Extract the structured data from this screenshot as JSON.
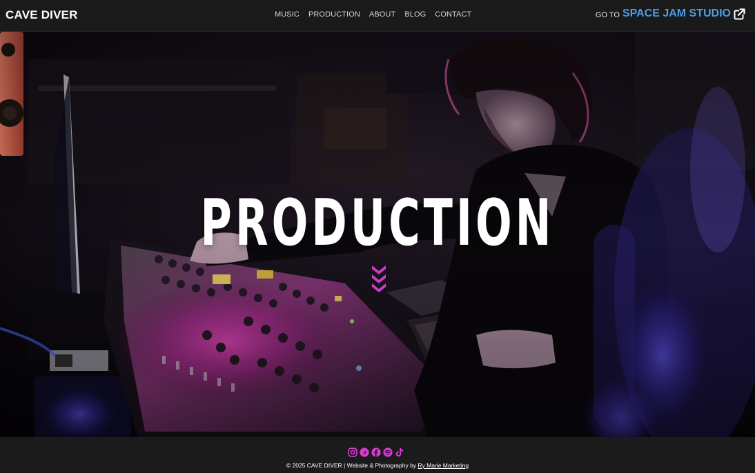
{
  "header": {
    "brand": "CAVE DIVER",
    "nav": [
      "MUSIC",
      "PRODUCTION",
      "ABOUT",
      "BLOG",
      "CONTACT"
    ],
    "goto_prefix": "GO TO",
    "goto_link": "SPACE JAM STUDIO",
    "goto_icon": "external-link-icon"
  },
  "hero": {
    "title": "PRODUCTION",
    "scroll_icon": "triple-chevron-down-icon"
  },
  "footer": {
    "social_icons": [
      "instagram-icon",
      "apple-music-icon",
      "facebook-icon",
      "spotify-icon",
      "tiktok-icon"
    ],
    "copyright_text": "© 2025 CAVE DIVER | Website & Photography by ",
    "credit_link": "Ry Marie Marketing"
  },
  "colors": {
    "accent_blue": "#4f9be8",
    "accent_magenta": "#d63bd0",
    "bar_bg": "#1a1a1a"
  }
}
